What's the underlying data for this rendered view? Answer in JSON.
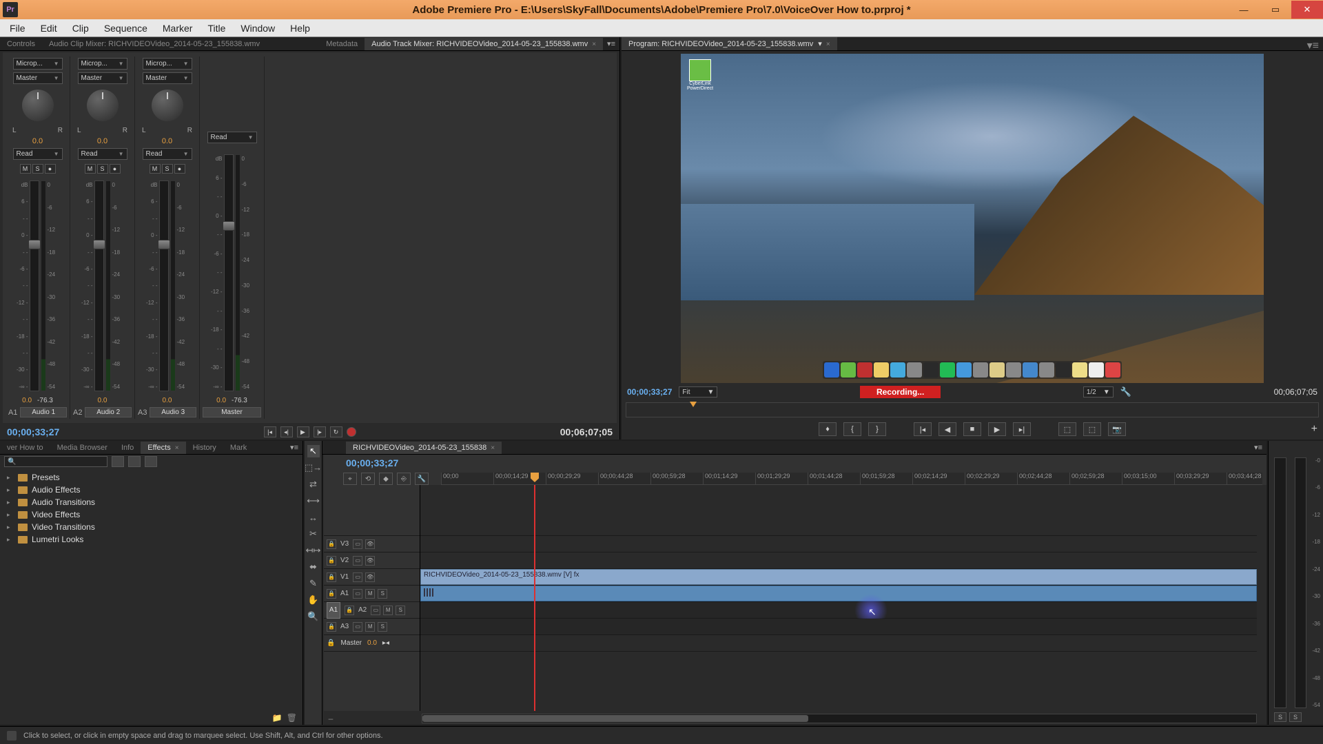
{
  "titlebar": {
    "app_icon": "Pr",
    "title": "Adobe Premiere Pro - E:\\Users\\SkyFall\\Documents\\Adobe\\Premiere Pro\\7.0\\VoiceOver How to.prproj *"
  },
  "menubar": [
    "File",
    "Edit",
    "Clip",
    "Sequence",
    "Marker",
    "Title",
    "Window",
    "Help"
  ],
  "mixer": {
    "tabs": [
      {
        "label": "Controls",
        "active": false
      },
      {
        "label": "Audio Clip Mixer: RICHVIDEOVideo_2014-05-23_155838.wmv",
        "active": false
      },
      {
        "label": "Metadata",
        "active": false
      },
      {
        "label": "Audio Track Mixer: RICHVIDEOVideo_2014-05-23_155838.wmv",
        "active": true
      }
    ],
    "channels": [
      {
        "input": "Microp...",
        "output": "Master",
        "pan": "0.0",
        "read": "Read",
        "db0": "0.0",
        "db1": "-76.3",
        "idx": "A1",
        "name": "Audio 1"
      },
      {
        "input": "Microp...",
        "output": "Master",
        "pan": "0.0",
        "read": "Read",
        "db0": "0.0",
        "db1": "",
        "idx": "A2",
        "name": "Audio 2"
      },
      {
        "input": "Microp...",
        "output": "Master",
        "pan": "0.0",
        "read": "Read",
        "db0": "0.0",
        "db1": "",
        "idx": "A3",
        "name": "Audio 3"
      },
      {
        "input": "",
        "output": "",
        "pan": "",
        "read": "Read",
        "db0": "0.0",
        "db1": "-76.3",
        "idx": "",
        "name": "Master"
      }
    ],
    "db_scale": [
      "dB",
      "6 -",
      "- -",
      "0 -",
      "- -",
      "-6 -",
      "- -",
      "-12 -",
      "- -",
      "-18 -",
      "- -",
      "-30 -",
      "-∞ -"
    ],
    "meter_scale": [
      "0",
      "-6",
      "-12",
      "-18",
      "-24",
      "-30",
      "-36",
      "-42",
      "-48",
      "-54"
    ],
    "footer_tc_left": "00;00;33;27",
    "footer_tc_right": "00;06;07;05"
  },
  "program": {
    "tab": "Program: RICHVIDEOVideo_2014-05-23_155838.wmv",
    "desktop_icon_label": "CyberLink PowerDirect",
    "dock_colors": [
      "#2a6ad0",
      "#66bb44",
      "#c03030",
      "#eecc66",
      "#44aadd",
      "#888",
      "#2a2a2a",
      "#22bb55",
      "#4499dd",
      "#888",
      "#ddcc88",
      "#888",
      "#4488cc",
      "#888",
      "#2a2a2a",
      "#eedd88",
      "#eeeeee",
      "#dd4444"
    ],
    "tc_left": "00;00;33;27",
    "fit": "Fit",
    "recording": "Recording...",
    "half": "1/2",
    "tc_right": "00;06;07;05"
  },
  "effects": {
    "tabs": [
      "ver How to",
      "Media Browser",
      "Info",
      "Effects",
      "History",
      "Mark"
    ],
    "active_tab": "Effects",
    "search_placeholder": "",
    "items": [
      "Presets",
      "Audio Effects",
      "Audio Transitions",
      "Video Effects",
      "Video Transitions",
      "Lumetri Looks"
    ]
  },
  "timeline": {
    "tab": "RICHVIDEOVideo_2014-05-23_155838",
    "tc": "00;00;33;27",
    "ruler": [
      "00;00",
      "00;00;14;29",
      "00;00;29;29",
      "00;00;44;28",
      "00;00;59;28",
      "00;01;14;29",
      "00;01;29;29",
      "00;01;44;28",
      "00;01;59;28",
      "00;02;14;29",
      "00;02;29;29",
      "00;02;44;28",
      "00;02;59;28",
      "00;03;15;00",
      "00;03;29;29",
      "00;03;44;28"
    ],
    "video_tracks": [
      {
        "label": "V3"
      },
      {
        "label": "V2"
      },
      {
        "label": "V1",
        "clip": "RICHVIDEOVideo_2014-05-23_155838.wmv [V]"
      }
    ],
    "audio_tracks": [
      {
        "label": "A1",
        "m": "M",
        "s": "S",
        "has_clip": true,
        "target": true
      },
      {
        "label": "A2",
        "m": "M",
        "s": "S"
      },
      {
        "label": "A3",
        "m": "M",
        "s": "S"
      }
    ],
    "master_label": "Master",
    "master_val": "0.0"
  },
  "right_meter_scale": [
    "-0",
    "-6",
    "-12",
    "-18",
    "-24",
    "-30",
    "-36",
    "-42",
    "-48",
    "-54"
  ],
  "statusbar": {
    "text": "Click to select, or click in empty space and drag to marquee select. Use Shift, Alt, and Ctrl for other options."
  }
}
